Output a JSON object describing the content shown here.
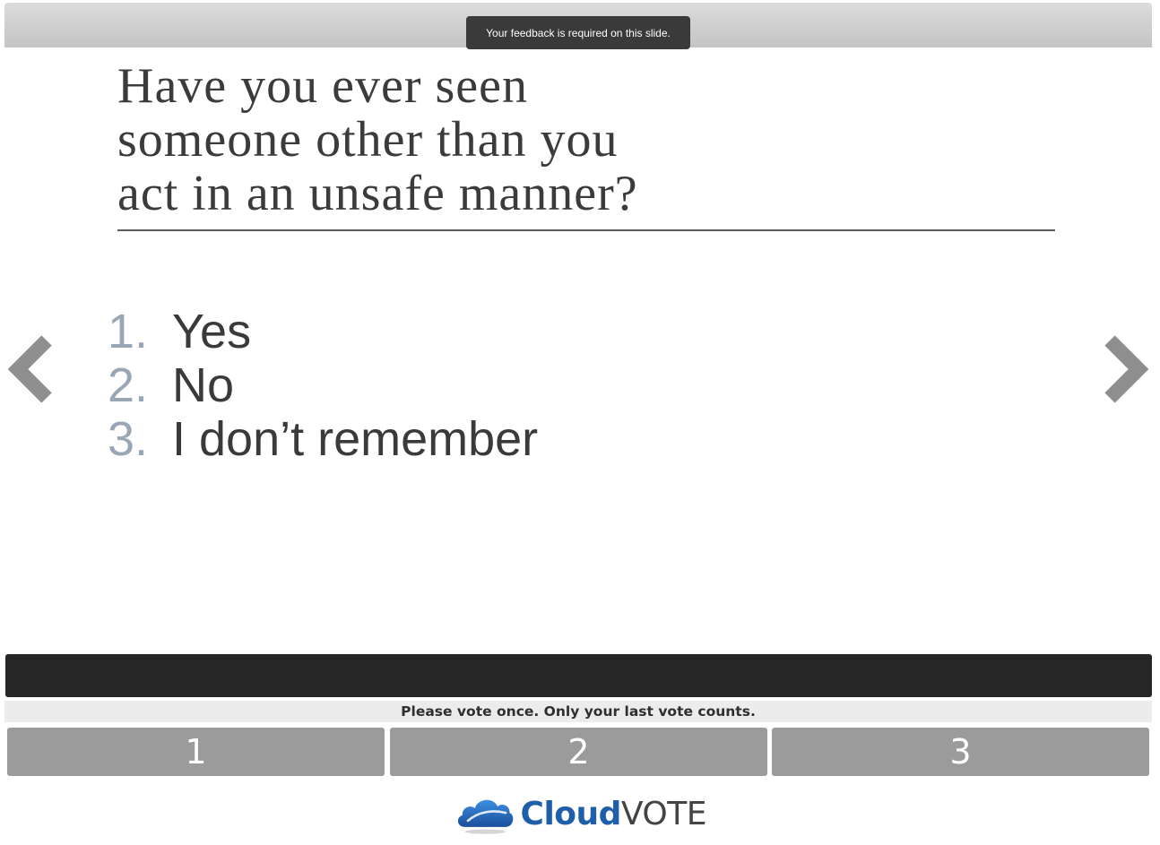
{
  "header": {
    "tooltip": "Your feedback is required on this slide."
  },
  "slide": {
    "question_lines": [
      "Have you ever seen",
      "someone other than you",
      "act in an unsafe manner?"
    ],
    "answers": [
      {
        "number": "1.",
        "label": "Yes"
      },
      {
        "number": "2.",
        "label": "No"
      },
      {
        "number": "3.",
        "label": "I don’t remember"
      }
    ]
  },
  "navigation": {
    "prev_icon": "chevron-left-icon",
    "next_icon": "chevron-right-icon"
  },
  "voting": {
    "instruction": "Please vote once. Only your last vote counts.",
    "buttons": [
      "1",
      "2",
      "3"
    ]
  },
  "logo": {
    "icon": "cloud-icon",
    "brand_cloud": "Cloud",
    "brand_vote": "VOTE"
  },
  "colors": {
    "answer_number": "#98a6b6",
    "vote_button": "#9b9b9b",
    "brand_blue": "#1f5ea8"
  }
}
